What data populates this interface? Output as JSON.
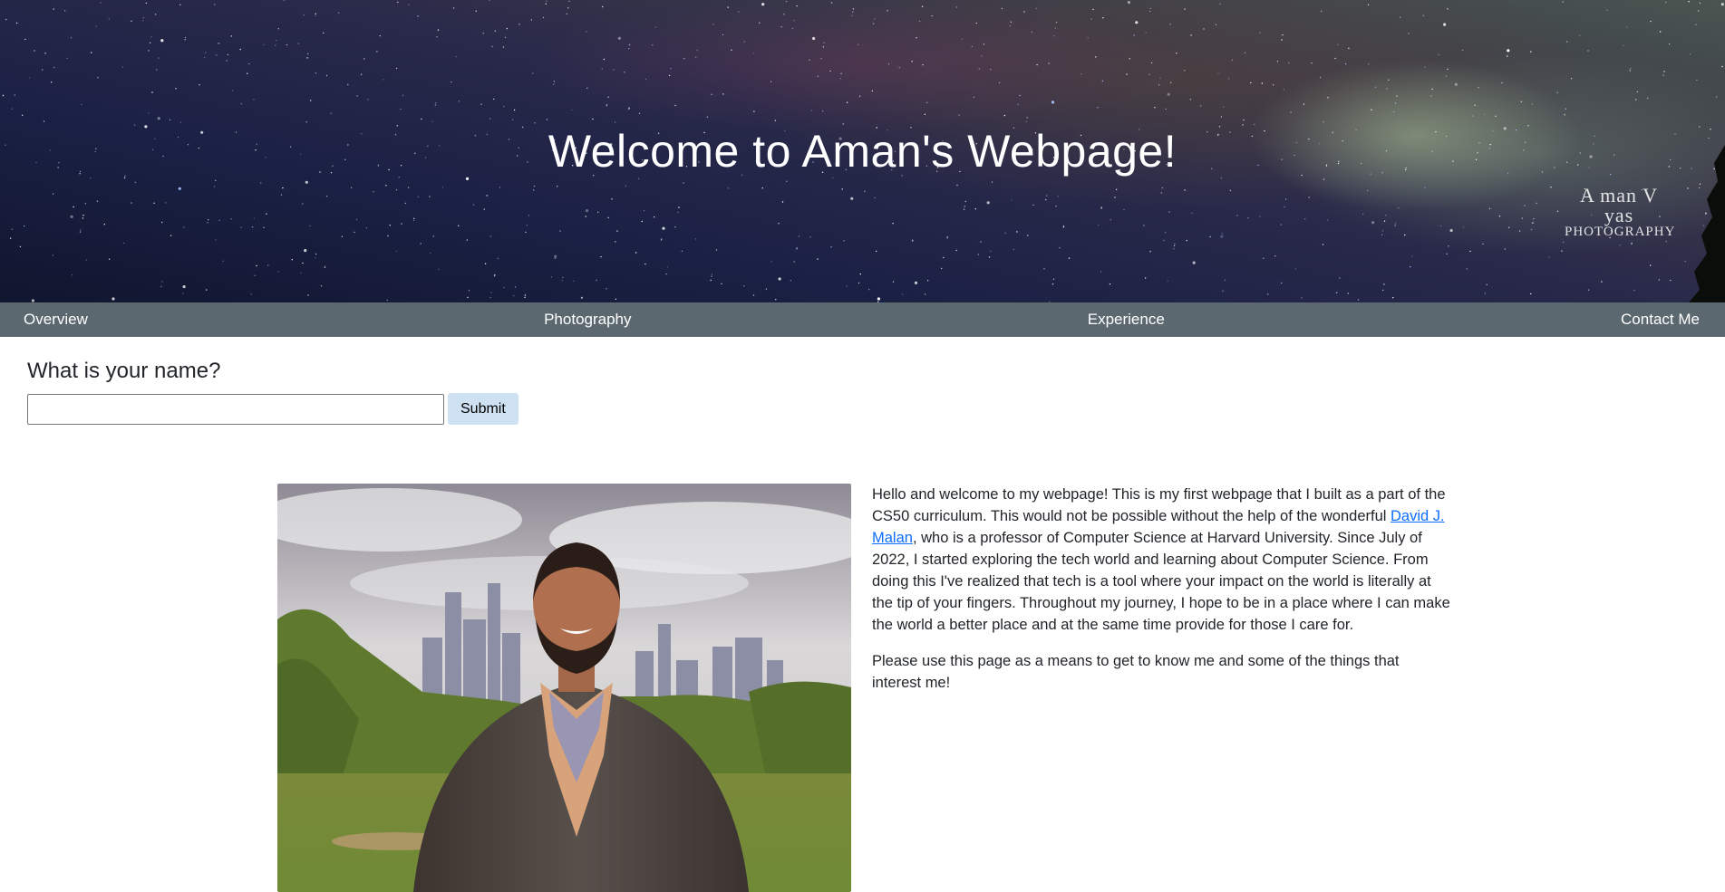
{
  "header": {
    "title": "Welcome to Aman's Webpage!",
    "watermark_top": "A man V yas",
    "watermark_bottom": "PHOTOGRAPHY"
  },
  "nav": {
    "items": [
      {
        "label": "Overview"
      },
      {
        "label": "Photography"
      },
      {
        "label": "Experience"
      },
      {
        "label": "Contact Me"
      }
    ]
  },
  "name_form": {
    "heading": "What is your name?",
    "input_value": "",
    "submit_label": "Submit"
  },
  "about": {
    "p1_before_link": "Hello and welcome to my webpage! This is my first webpage that I built as a part of the CS50 curriculum. This would not be possible without the help of the wonderful ",
    "link_text": "David J. Malan",
    "p1_after_link": ", who is a professor of Computer Science at Harvard University. Since July of 2022, I started exploring the tech world and learning about Computer Science. From doing this I've realized that tech is a tool where your impact on the world is literally at the tip of your fingers. Throughout my journey, I hope to be in a place where I can make the world a better place and at the same time provide for those I care for.",
    "p2": "Please use this page as a means to get to know me and some of the things that interest me!"
  },
  "colors": {
    "navbar": "#5c6870",
    "link": "#0d6efd",
    "submit_bg": "#cfe2f3"
  }
}
